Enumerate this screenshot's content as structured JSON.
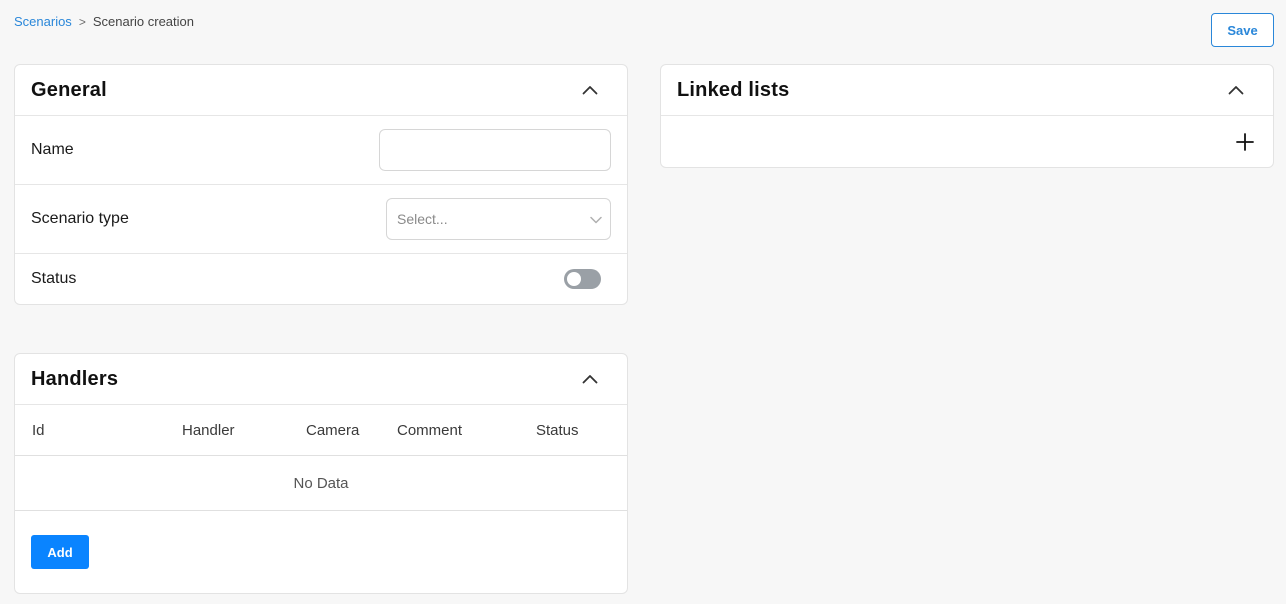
{
  "breadcrumb": {
    "parent": "Scenarios",
    "separator": ">",
    "current": "Scenario creation"
  },
  "toolbar": {
    "save_label": "Save"
  },
  "general": {
    "title": "General",
    "name_label": "Name",
    "name_value": "",
    "scenario_type_label": "Scenario type",
    "scenario_type_placeholder": "Select...",
    "status_label": "Status",
    "status_on": false
  },
  "handlers": {
    "title": "Handlers",
    "columns": [
      "Id",
      "Handler",
      "Camera",
      "Comment",
      "Status"
    ],
    "empty_text": "No Data",
    "add_label": "Add"
  },
  "linked_lists": {
    "title": "Linked lists"
  },
  "colors": {
    "accent": "#2a87d9",
    "primary_button": "#0a84ff",
    "toggle_off": "#9aa0a6"
  }
}
